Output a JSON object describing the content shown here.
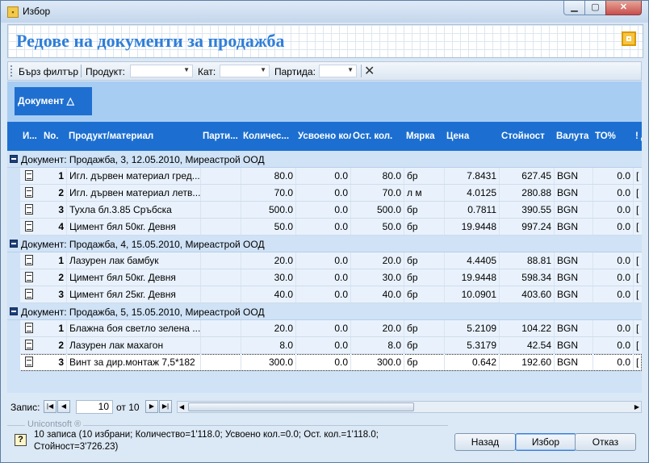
{
  "window": {
    "title": "Избор",
    "min_label": "▁",
    "max_label": "▢",
    "close_label": "✕"
  },
  "header": {
    "title": "Редове на документи за продажба"
  },
  "filter": {
    "quick_filter_label": "Бърз филтър",
    "product_label": "Продукт:",
    "product_value": "",
    "cat_label": "Кат:",
    "cat_value": "",
    "batch_label": "Партида:",
    "batch_value": ""
  },
  "grouping": {
    "chip_label": "Документ",
    "sort_glyph": "△"
  },
  "grid": {
    "columns": [
      {
        "key": "icon",
        "label": "И..."
      },
      {
        "key": "no",
        "label": "No."
      },
      {
        "key": "product",
        "label": "Продукт/материал"
      },
      {
        "key": "batch",
        "label": "Парти..."
      },
      {
        "key": "qty",
        "label": "Количес..."
      },
      {
        "key": "absorbed",
        "label": "Усвоено кол."
      },
      {
        "key": "rest",
        "label": "Ост. кол."
      },
      {
        "key": "unit",
        "label": "Мярка"
      },
      {
        "key": "price",
        "label": "Цена"
      },
      {
        "key": "value",
        "label": "Стойност"
      },
      {
        "key": "currency",
        "label": "Валута"
      },
      {
        "key": "to",
        "label": "ТО%"
      },
      {
        "key": "extra",
        "label": "! Д"
      }
    ],
    "groups": [
      {
        "label": "Документ: Продажба, 3, 12.05.2010, Миреастрой ООД",
        "rows": [
          {
            "no": "1",
            "product": "Игл. дървен материал гред...",
            "batch": "",
            "qty": "80.0",
            "absorbed": "0.0",
            "rest": "80.0",
            "unit": "бр",
            "price": "7.8431",
            "value": "627.45",
            "currency": "BGN",
            "to": "0.0",
            "extra": "["
          },
          {
            "no": "2",
            "product": "Игл. дървен материал летв...",
            "batch": "",
            "qty": "70.0",
            "absorbed": "0.0",
            "rest": "70.0",
            "unit": "л м",
            "price": "4.0125",
            "value": "280.88",
            "currency": "BGN",
            "to": "0.0",
            "extra": "["
          },
          {
            "no": "3",
            "product": "Тухла бл.3.85 Сръбска",
            "batch": "",
            "qty": "500.0",
            "absorbed": "0.0",
            "rest": "500.0",
            "unit": "бр",
            "price": "0.7811",
            "value": "390.55",
            "currency": "BGN",
            "to": "0.0",
            "extra": "["
          },
          {
            "no": "4",
            "product": "Цимент бял 50кг. Девня",
            "batch": "",
            "qty": "50.0",
            "absorbed": "0.0",
            "rest": "50.0",
            "unit": "бр",
            "price": "19.9448",
            "value": "997.24",
            "currency": "BGN",
            "to": "0.0",
            "extra": "["
          }
        ]
      },
      {
        "label": "Документ: Продажба, 4, 15.05.2010, Миреастрой ООД",
        "rows": [
          {
            "no": "1",
            "product": "Лазурен лак бамбук",
            "batch": "",
            "qty": "20.0",
            "absorbed": "0.0",
            "rest": "20.0",
            "unit": "бр",
            "price": "4.4405",
            "value": "88.81",
            "currency": "BGN",
            "to": "0.0",
            "extra": "["
          },
          {
            "no": "2",
            "product": "Цимент бял 50кг. Девня",
            "batch": "",
            "qty": "30.0",
            "absorbed": "0.0",
            "rest": "30.0",
            "unit": "бр",
            "price": "19.9448",
            "value": "598.34",
            "currency": "BGN",
            "to": "0.0",
            "extra": "["
          },
          {
            "no": "3",
            "product": "Цимент бял 25кг. Девня",
            "batch": "",
            "qty": "40.0",
            "absorbed": "0.0",
            "rest": "40.0",
            "unit": "бр",
            "price": "10.0901",
            "value": "403.60",
            "currency": "BGN",
            "to": "0.0",
            "extra": "["
          }
        ]
      },
      {
        "label": "Документ: Продажба, 5, 15.05.2010, Миреастрой ООД",
        "rows": [
          {
            "no": "1",
            "product": "Блажна боя светло зелена ...",
            "batch": "",
            "qty": "20.0",
            "absorbed": "0.0",
            "rest": "20.0",
            "unit": "бр",
            "price": "5.2109",
            "value": "104.22",
            "currency": "BGN",
            "to": "0.0",
            "extra": "["
          },
          {
            "no": "2",
            "product": "Лазурен лак махагон",
            "batch": "",
            "qty": "8.0",
            "absorbed": "0.0",
            "rest": "8.0",
            "unit": "бр",
            "price": "5.3179",
            "value": "42.54",
            "currency": "BGN",
            "to": "0.0",
            "extra": "["
          },
          {
            "no": "3",
            "product": "Винт за дир.монтаж 7,5*182",
            "batch": "",
            "qty": "300.0",
            "absorbed": "0.0",
            "rest": "300.0",
            "unit": "бр",
            "price": "0.642",
            "value": "192.60",
            "currency": "BGN",
            "to": "0.0",
            "extra": "[",
            "selected": true
          }
        ]
      }
    ]
  },
  "navigator": {
    "label": "Запис:",
    "position": "10",
    "of_label": "от 10"
  },
  "status": {
    "brand": "Unicontsoft ®",
    "text": "10 записа (10 избрани; Количество=1'118.0; Усвоено кол.=0.0; Ост. кол.=1'118.0; Стойност=3'726.23)"
  },
  "buttons": {
    "back": "Назад",
    "select": "Избор",
    "cancel": "Отказ"
  }
}
